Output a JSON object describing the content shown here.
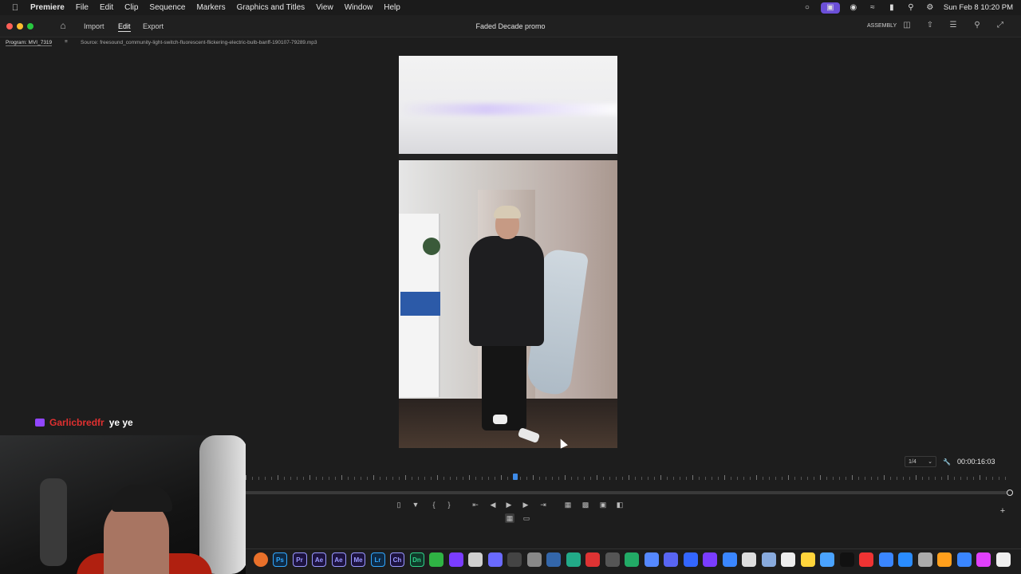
{
  "menubar": {
    "app_name": "Premiere",
    "items": [
      "File",
      "Edit",
      "Clip",
      "Sequence",
      "Markers",
      "Graphics and Titles",
      "View",
      "Window",
      "Help"
    ],
    "clock": "Sun Feb 8  10:20 PM",
    "status_icons": [
      "creative-cloud-icon",
      "screen-record-icon",
      "app-icon",
      "wifi-icon",
      "battery-icon",
      "search-icon",
      "control-center-icon"
    ]
  },
  "titlebar": {
    "tabs": [
      "Import",
      "Edit",
      "Export"
    ],
    "active_tab": "Edit",
    "project_title": "Faded Decade promo",
    "workspace": "ASSEMBLY"
  },
  "panel": {
    "program_label": "Program: MVI_7319",
    "menu_icon": "≡",
    "source_label": "Source: freesound_community-light-switch-fluorescent-flickering-electric-bulb-banff-190107-79289.mp3"
  },
  "chat": {
    "username": "Garlicbredfr",
    "message": "ye ye",
    "username_color": "#e03030"
  },
  "transport": {
    "zoom": "1/4",
    "timecode": "00:00:16:03",
    "controls": [
      "lift-icon",
      "marker-icon",
      "mark-in-icon",
      "mark-out-icon",
      "go-to-in-icon",
      "step-back-icon",
      "play-icon",
      "step-forward-icon",
      "go-to-out-icon",
      "insert-icon",
      "overwrite-icon",
      "export-frame-icon",
      "comparison-icon"
    ]
  },
  "dock": {
    "apps": [
      {
        "label": "Ps",
        "color": "#0e2a45",
        "text": "#31a8ff"
      },
      {
        "label": "Pr",
        "color": "#1d1340",
        "text": "#9999ff"
      },
      {
        "label": "Ae",
        "color": "#1d1340",
        "text": "#9999ff"
      },
      {
        "label": "Ae",
        "color": "#1d1340",
        "text": "#9999ff"
      },
      {
        "label": "Me",
        "color": "#1d1340",
        "text": "#9999ff"
      },
      {
        "label": "Lr",
        "color": "#0e2a45",
        "text": "#31a8ff"
      },
      {
        "label": "Ch",
        "color": "#1d1340",
        "text": "#9999ff"
      },
      {
        "label": "Dn",
        "color": "#0f3a2a",
        "text": "#2fd28a"
      }
    ]
  },
  "colors": {
    "accent_playhead": "#3e8be8",
    "twitch_purple": "#9146ff"
  }
}
